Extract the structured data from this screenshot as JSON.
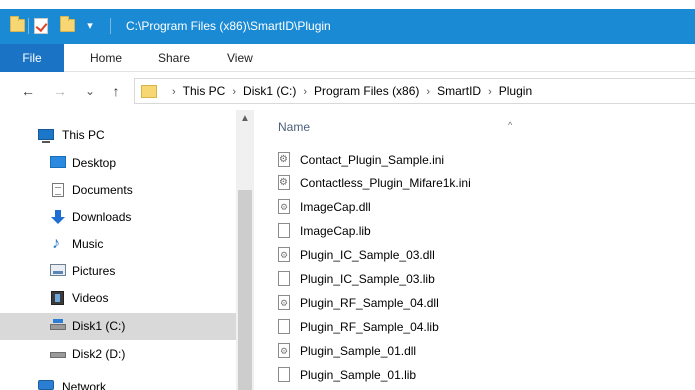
{
  "window": {
    "title": "C:\\Program Files (x86)\\SmartID\\Plugin",
    "qa_dropdown": "▾"
  },
  "ribbon": {
    "tabs": [
      "File",
      "Home",
      "Share",
      "View"
    ]
  },
  "nav": {
    "back": "←",
    "forward": "→",
    "recent": "⌄",
    "up": "↑"
  },
  "breadcrumbs": [
    "This PC",
    "Disk1 (C:)",
    "Program Files (x86)",
    "SmartID",
    "Plugin"
  ],
  "breadcrumb_separator": "›",
  "sidebar": {
    "items": [
      {
        "label": "This PC",
        "icon": "computer-icon"
      },
      {
        "label": "Desktop",
        "icon": "desktop-icon"
      },
      {
        "label": "Documents",
        "icon": "documents-icon"
      },
      {
        "label": "Downloads",
        "icon": "downloads-icon"
      },
      {
        "label": "Music",
        "icon": "music-icon"
      },
      {
        "label": "Pictures",
        "icon": "pictures-icon"
      },
      {
        "label": "Videos",
        "icon": "videos-icon"
      },
      {
        "label": "Disk1 (C:)",
        "icon": "drive-icon",
        "selected": true
      },
      {
        "label": "Disk2 (D:)",
        "icon": "drive-icon"
      },
      {
        "label": "Network",
        "icon": "network-icon"
      }
    ],
    "scroll_up": "▲"
  },
  "filelist": {
    "column_name": "Name",
    "sort_indicator": "^",
    "files": [
      {
        "name": "Contact_Plugin_Sample.ini",
        "icon": "settings-file-icon"
      },
      {
        "name": "Contactless_Plugin_Mifare1k.ini",
        "icon": "settings-file-icon"
      },
      {
        "name": "ImageCap.dll",
        "icon": "dll-file-icon"
      },
      {
        "name": "ImageCap.lib",
        "icon": "file-icon"
      },
      {
        "name": "Plugin_IC_Sample_03.dll",
        "icon": "dll-file-icon"
      },
      {
        "name": "Plugin_IC_Sample_03.lib",
        "icon": "file-icon"
      },
      {
        "name": "Plugin_RF_Sample_04.dll",
        "icon": "dll-file-icon"
      },
      {
        "name": "Plugin_RF_Sample_04.lib",
        "icon": "file-icon"
      },
      {
        "name": "Plugin_Sample_01.dll",
        "icon": "dll-file-icon"
      },
      {
        "name": "Plugin_Sample_01.lib",
        "icon": "file-icon"
      }
    ]
  },
  "colors": {
    "titlebar": "#1a8ad4",
    "file_tab": "#1a73c4",
    "selected_item": "#d9d9d9"
  }
}
